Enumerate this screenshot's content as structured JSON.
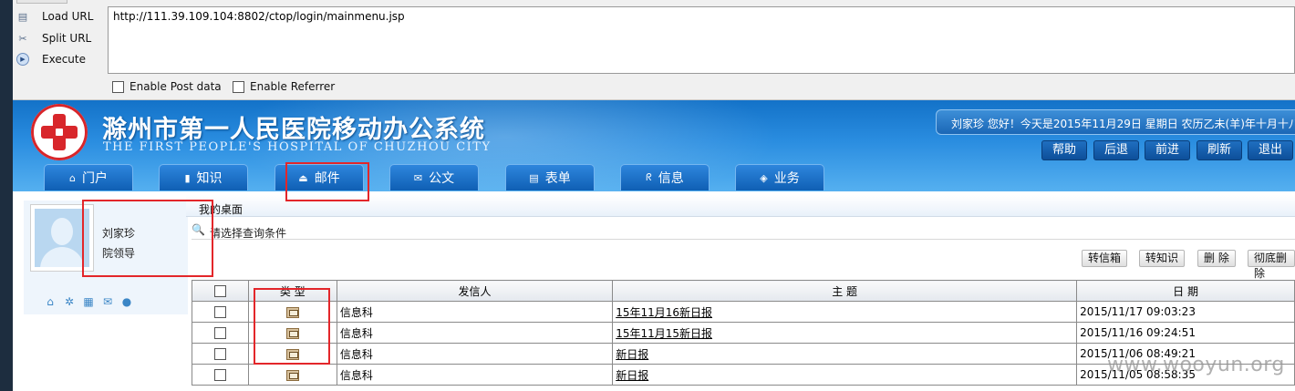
{
  "hackbar": {
    "buttons": [
      "Load URL",
      "Split URL",
      "Execute"
    ],
    "url": "http://111.39.109.104:8802/ctop/login/mainmenu.jsp",
    "options": [
      "Enable Post data",
      "Enable Referrer"
    ]
  },
  "header": {
    "title_cn": "滁州市第一人民医院移动办公系统",
    "title_en": "THE FIRST PEOPLE'S HOSPITAL OF CHUZHOU CITY",
    "user_greeting": "刘家珍  您好！今天是2015年11月29日  星期日  农历乙未(羊)年十月十八",
    "top_buttons": [
      "帮助",
      "后退",
      "前进",
      "刷新",
      "退出"
    ],
    "nav_tabs": [
      "门户",
      "知识",
      "邮件",
      "公文",
      "表单",
      "信息",
      "业务"
    ]
  },
  "profile": {
    "name": "刘家珍",
    "role": "院领导"
  },
  "desk": {
    "label": "我的桌面",
    "query": "请选择查询条件"
  },
  "actions": [
    "转信箱",
    "转知识",
    "删 除",
    "彻底删除"
  ],
  "table": {
    "headers": [
      "类 型",
      "发信人",
      "主 题",
      "日 期"
    ],
    "rows": [
      {
        "sender": "信息科",
        "subject": "15年11月16新日报",
        "date": "2015/11/17 09:03:23"
      },
      {
        "sender": "信息科",
        "subject": "15年11月15新日报",
        "date": "2015/11/16 09:24:51"
      },
      {
        "sender": "信息科",
        "subject": "新日报",
        "date": "2015/11/06 08:49:21"
      },
      {
        "sender": "信息科",
        "subject": "新日报",
        "date": "2015/11/05 08:58:35"
      }
    ]
  },
  "watermark": "www.wooyun.org",
  "colors": {
    "header_blue": "#1372c8",
    "highlight_red": "#e3262a",
    "logo_red": "#d8262b"
  }
}
